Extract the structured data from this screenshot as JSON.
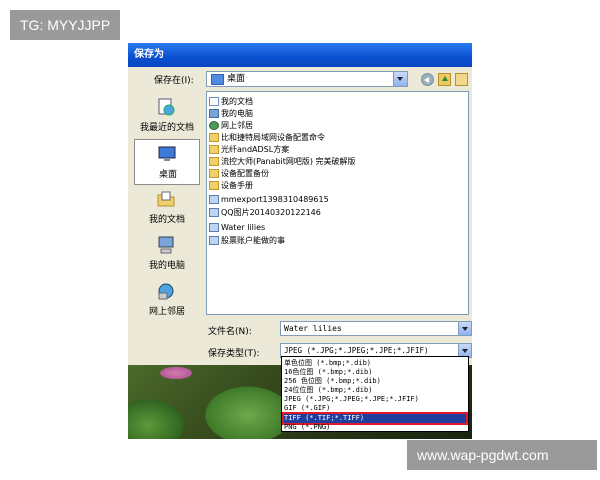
{
  "watermarks": {
    "top": "TG: MYYJJPP",
    "bottom": "www.wap-pgdwt.com"
  },
  "window": {
    "title": "保存为"
  },
  "toolbar": {
    "save_in_label": "保存在(I):",
    "save_in_value": "桌面"
  },
  "places": [
    {
      "label": "我最近的文档",
      "icon": "recent-documents-icon"
    },
    {
      "label": "桌面",
      "icon": "desktop-icon"
    },
    {
      "label": "我的文档",
      "icon": "my-documents-icon"
    },
    {
      "label": "我的电脑",
      "icon": "my-computer-icon"
    },
    {
      "label": "网上邻居",
      "icon": "network-places-icon"
    }
  ],
  "files": [
    {
      "name": "我的文档",
      "icon": "doc"
    },
    {
      "name": "我的电脑",
      "icon": "comp"
    },
    {
      "name": "网上邻居",
      "icon": "net"
    },
    {
      "name": "比和捷特局域网设备配置命令",
      "icon": "folder"
    },
    {
      "name": "光纤andADSL方案",
      "icon": "folder"
    },
    {
      "name": "流控大师(Panabit网吧版) 完美破解版",
      "icon": "folder"
    },
    {
      "name": "设备配置备份",
      "icon": "folder"
    },
    {
      "name": "设备手册",
      "icon": "folder"
    },
    {
      "name": "mmexport1398310489615",
      "icon": "img"
    },
    {
      "name": "QQ图片20140320122146",
      "icon": "img"
    },
    {
      "name": "Water lilies",
      "icon": "img"
    },
    {
      "name": "股票账户能做的事",
      "icon": "img"
    }
  ],
  "filename": {
    "label": "文件名(N):",
    "value": "Water lilies"
  },
  "filetype": {
    "label": "保存类型(T):",
    "value": "JPEG (*.JPG;*.JPEG;*.JPE;*.JFIF)"
  },
  "type_options": [
    "单色位图 (*.bmp;*.dib)",
    "16色位图 (*.bmp;*.dib)",
    "256 色位图 (*.bmp;*.dib)",
    "24位位图 (*.bmp;*.dib)",
    "JPEG (*.JPG;*.JPEG;*.JPE;*.JFIF)",
    "GIF (*.GIF)",
    "TIFF (*.TIF;*.TIFF)",
    "PNG (*.PNG)"
  ],
  "selected_type_index": 6,
  "colors": {
    "titlebar": "#0a4fd0",
    "highlight": "#1f3fa0",
    "highlight_outline": "#e01a2a",
    "dialog_bg": "#ece9d8"
  }
}
